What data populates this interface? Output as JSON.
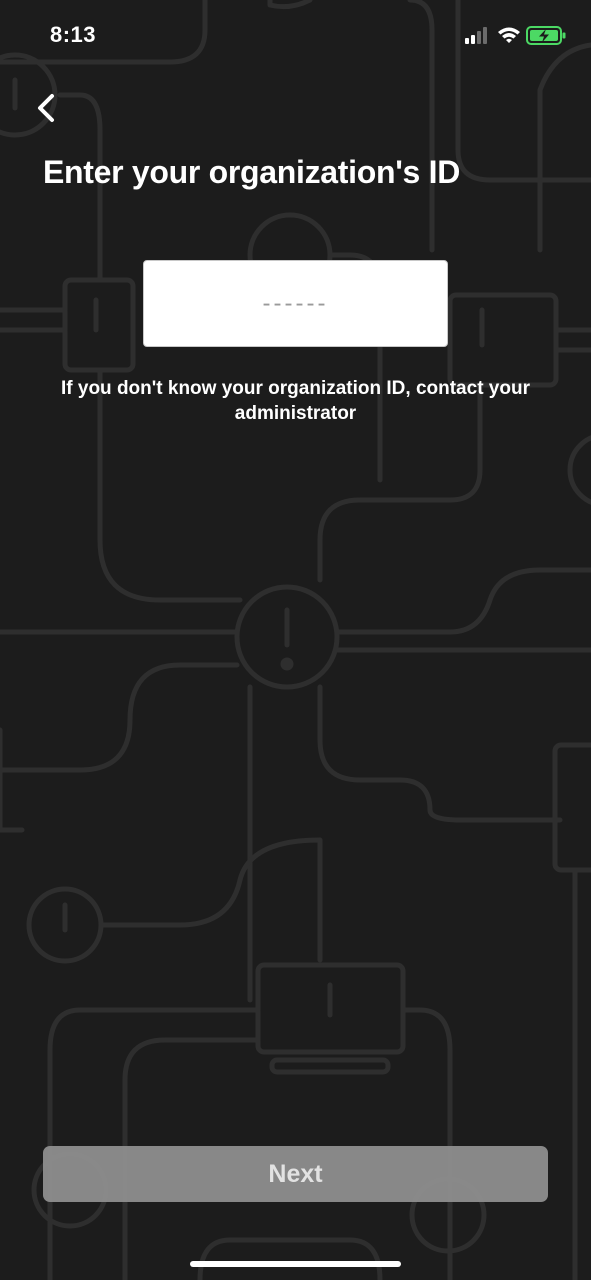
{
  "status_bar": {
    "time": "8:13",
    "icons": [
      "cellular-signal-icon",
      "wifi-icon",
      "battery-charging-icon"
    ],
    "battery_color": "#4cd964"
  },
  "header": {
    "back_icon": "chevron-left-icon",
    "title": "Enter your organization's ID"
  },
  "form": {
    "org_id_value": "",
    "org_id_placeholder": "------",
    "help_text": "If you don't know your organization ID, contact your administrator"
  },
  "footer": {
    "next_label": "Next"
  },
  "colors": {
    "background": "#1c1c1c",
    "pattern_stroke": "#2c2c2c",
    "button_bg": "#8e8e8e"
  }
}
